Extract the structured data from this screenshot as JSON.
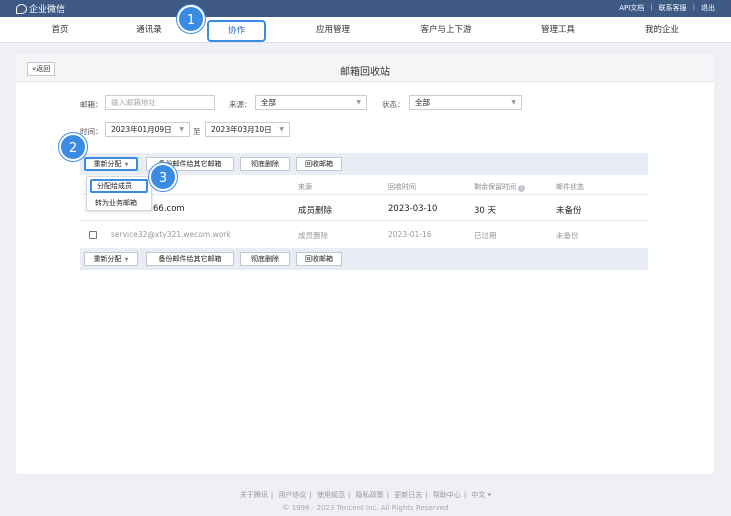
{
  "app": {
    "name": "企业微信"
  },
  "top_links": [
    "API文档",
    "联系客服",
    "退出"
  ],
  "nav": {
    "items": [
      "首页",
      "通讯录",
      "协作",
      "应用管理",
      "客户与上下游",
      "管理工具",
      "我的企业"
    ],
    "active_index": 2
  },
  "callouts": [
    "1",
    "2",
    "3"
  ],
  "page": {
    "title": "邮箱回收站",
    "back_label": "返回"
  },
  "filters": {
    "email_label": "邮箱：",
    "email_placeholder": "输入邮箱地址",
    "source_label": "来源：",
    "source_value": "全部",
    "status_label": "状态：",
    "status_value": "全部",
    "time_label": "时间：",
    "date_from": "2023年01月09日",
    "date_to_sep": "至",
    "date_to": "2023年03月10日"
  },
  "toolbar": {
    "reassign": "重新分配",
    "backup": "备份邮件给其它邮箱",
    "delete": "彻底删除",
    "recycle": "回收邮箱"
  },
  "dropdown": {
    "items": [
      "分配给成员",
      "转为业务邮箱"
    ]
  },
  "table": {
    "headers": [
      "来源",
      "回收时间",
      "剩余保留时间",
      "邮件状态"
    ],
    "rows": [
      {
        "email": "66.com",
        "source": "成员删除",
        "time": "2023-03-10",
        "remaining": "30 天",
        "status": "未备份"
      },
      {
        "email": "service32@xty321.wecom.work",
        "source": "成员删除",
        "time": "2023-01-16",
        "remaining": "已过期",
        "status": "未备份"
      }
    ]
  },
  "footer": {
    "links": [
      "关于腾讯",
      "用户协议",
      "使用规范",
      "隐私政策",
      "更新日志",
      "帮助中心",
      "中文 ▾"
    ],
    "copyright": "© 1998 - 2023 Tencent Inc. All Rights Reserved"
  },
  "colors": {
    "topbar": "#3e5a84",
    "highlight": "#3c8be2",
    "toolbar": "#e8edf5"
  }
}
